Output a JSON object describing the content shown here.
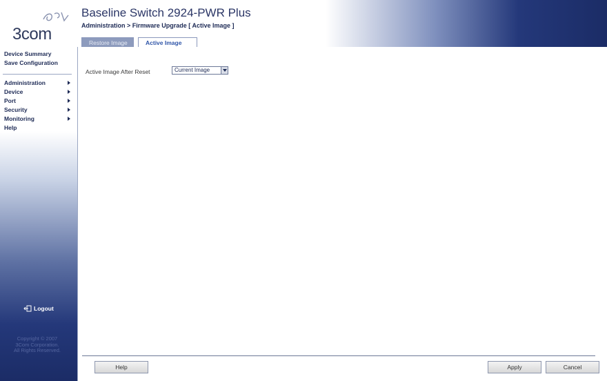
{
  "sidebar": {
    "logo_text": "3com",
    "links": [
      "Device Summary",
      "Save Configuration"
    ],
    "menu": [
      {
        "label": "Administration",
        "arrow": true
      },
      {
        "label": "Device",
        "arrow": true
      },
      {
        "label": "Port",
        "arrow": true
      },
      {
        "label": "Security",
        "arrow": true
      },
      {
        "label": "Monitoring",
        "arrow": true
      },
      {
        "label": "Help",
        "arrow": false
      }
    ],
    "logout_label": "Logout",
    "copyright": [
      "Copyright © 2007",
      "3Com Corporation.",
      "All Rights Reserved."
    ]
  },
  "header": {
    "title": "Baseline Switch 2924-PWR Plus",
    "breadcrumb": "Administration > Firmware Upgrade [ Active Image ]",
    "tabs": [
      {
        "label": "Restore Image",
        "active": false
      },
      {
        "label": "Active Image",
        "active": true
      }
    ]
  },
  "main": {
    "field_label": "Active Image After Reset",
    "select_value": "Current Image"
  },
  "buttons": {
    "help": "Help",
    "apply": "Apply",
    "cancel": "Cancel"
  },
  "colors": {
    "navy": "#1b2c66",
    "tab_active_text": "#2f55a8"
  }
}
